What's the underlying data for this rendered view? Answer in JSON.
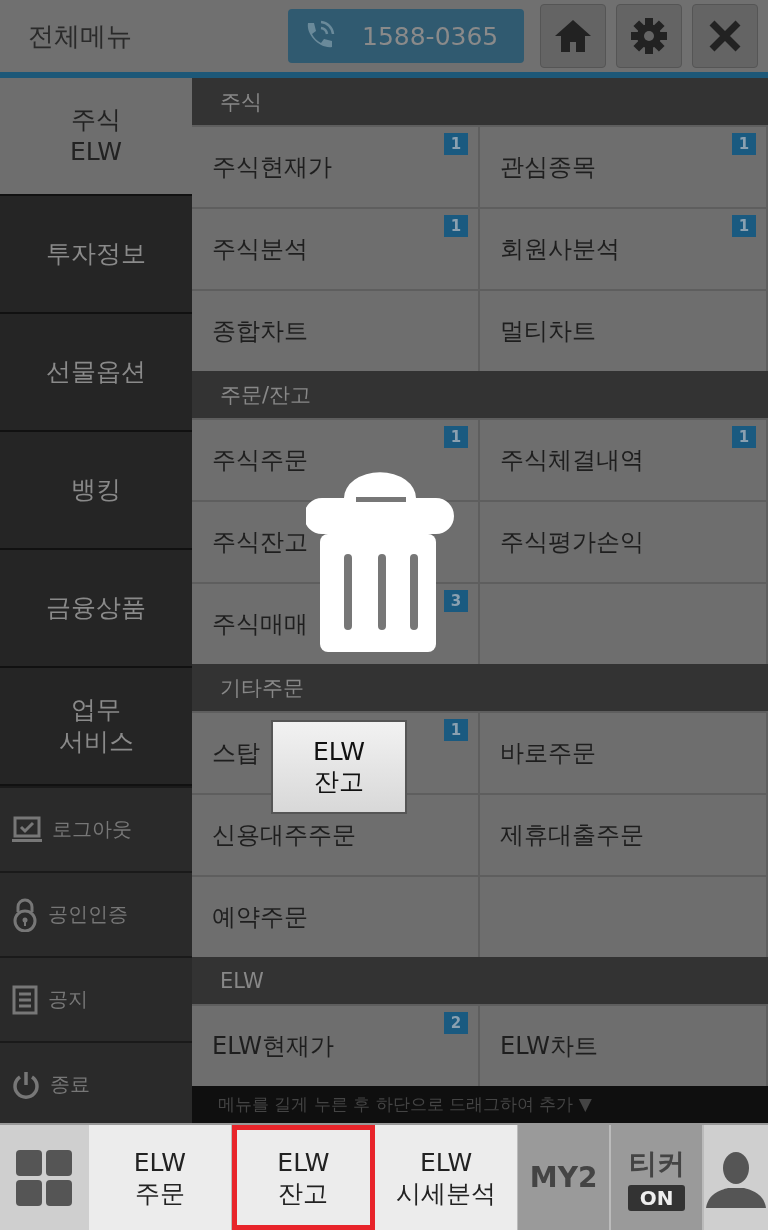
{
  "header": {
    "title": "전체메뉴",
    "phone": "1588-0365"
  },
  "sidebar": {
    "items": [
      {
        "lines": [
          "주식",
          "ELW"
        ],
        "selected": true
      },
      {
        "lines": [
          "투자정보"
        ],
        "selected": false
      },
      {
        "lines": [
          "선물옵션"
        ],
        "selected": false
      },
      {
        "lines": [
          "뱅킹"
        ],
        "selected": false
      },
      {
        "lines": [
          "금융상품"
        ],
        "selected": false
      },
      {
        "lines": [
          "업무",
          "서비스"
        ],
        "selected": false
      }
    ],
    "tools": [
      {
        "label": "로그아웃"
      },
      {
        "label": "공인인증"
      },
      {
        "label": "공지"
      },
      {
        "label": "종료"
      }
    ]
  },
  "sections": [
    {
      "title": "주식",
      "cells": [
        {
          "label": "주식현재가",
          "badge": "1"
        },
        {
          "label": "관심종목",
          "badge": "1"
        },
        {
          "label": "주식분석",
          "badge": "1"
        },
        {
          "label": "회원사분석",
          "badge": "1"
        },
        {
          "label": "종합차트"
        },
        {
          "label": "멀티차트"
        }
      ]
    },
    {
      "title": "주문/잔고",
      "cells": [
        {
          "label": "주식주문",
          "badge": "1"
        },
        {
          "label": "주식체결내역",
          "badge": "1"
        },
        {
          "label": "주식잔고"
        },
        {
          "label": "주식평가손익"
        },
        {
          "label": "주식매매",
          "badge": "3"
        },
        {}
      ]
    },
    {
      "title": "기타주문",
      "cells": [
        {
          "label": "스탑",
          "badge": "1"
        },
        {
          "label": "바로주문"
        },
        {
          "label": "신용대주주문"
        },
        {
          "label": "제휴대출주문"
        },
        {
          "label": "예약주문"
        },
        {}
      ]
    },
    {
      "title": "ELW",
      "cells": [
        {
          "label": "ELW현재가",
          "badge": "2"
        },
        {
          "label": "ELW차트"
        }
      ]
    }
  ],
  "hint": "메뉴를 길게 누른 후 하단으로 드래그하여 추가 ▼",
  "drag_ghost": {
    "lines": [
      "ELW",
      "잔고"
    ]
  },
  "bottom_bar": {
    "items": [
      {
        "lines": [
          "ELW",
          "주문"
        ],
        "selected": false
      },
      {
        "lines": [
          "ELW",
          "잔고"
        ],
        "selected": true
      },
      {
        "lines": [
          "ELW",
          "시세분석"
        ],
        "selected": false
      }
    ],
    "my": "MY2",
    "ticker": {
      "label": "티커",
      "state": "ON",
      "on": true
    }
  }
}
